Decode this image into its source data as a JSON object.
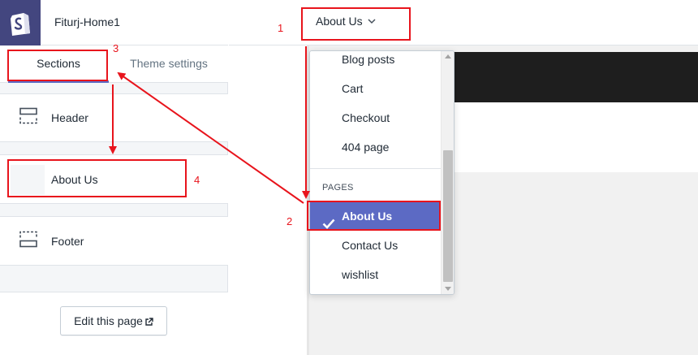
{
  "app": {
    "store_name": "Fiturj-Home1"
  },
  "tabs": [
    {
      "label": "Sections"
    },
    {
      "label": "Theme settings"
    }
  ],
  "sections": [
    {
      "label": "Header"
    },
    {
      "label": "About Us"
    },
    {
      "label": "Footer"
    }
  ],
  "sidebar_footer": {
    "edit_button_label": "Edit this page"
  },
  "page_selector": {
    "current": "About Us"
  },
  "dropdown": {
    "items_before": [
      "Blog posts",
      "Cart",
      "Checkout",
      "404 page"
    ],
    "pages_heading": "PAGES",
    "selected": "About Us",
    "items_after": [
      "Contact Us",
      "wishlist"
    ]
  },
  "annotations": {
    "color": "#e8141c",
    "labels": [
      "1",
      "2",
      "3",
      "4"
    ]
  },
  "colors": {
    "brand_purple": "#5c6ac4",
    "logo_bg": "#43467f",
    "annotation_red": "#e8141c"
  }
}
